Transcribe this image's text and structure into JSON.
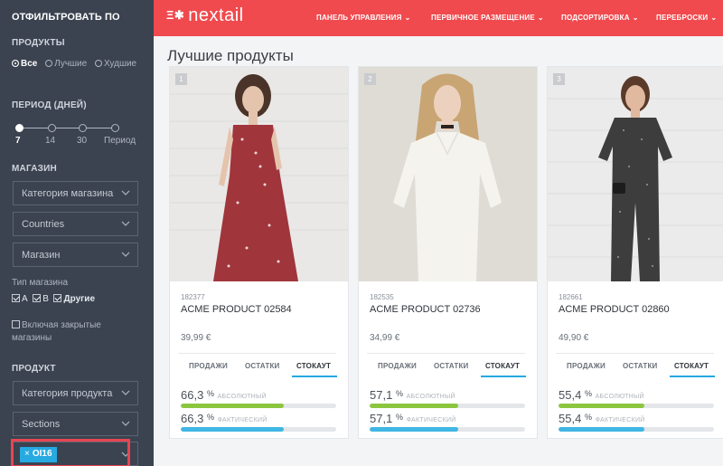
{
  "sidebar": {
    "title": "ОТФИЛЬТРОВАТЬ ПО",
    "products_heading": "ПРОДУКТЫ",
    "product_options": [
      "Все",
      "Лучшие",
      "Худшие"
    ],
    "product_selected": "Все",
    "period_heading": "ПЕРИОД (ДНЕЙ)",
    "period_options": [
      "7",
      "14",
      "30",
      "Период"
    ],
    "period_selected": "7",
    "stores_heading": "МАГАЗИН",
    "store_category": "Категория магазина",
    "countries": "Countries",
    "store": "Магазин",
    "store_type_label": "Тип магазина",
    "store_types": [
      "A",
      "B",
      "Другие"
    ],
    "include_closed": "Включая закрытые магазины",
    "product_heading": "ПРОДУКТ",
    "product_category": "Категория продукта",
    "sections": "Sections",
    "tag": "OI16",
    "tag_remove": "×"
  },
  "topbar": {
    "logo": "nextail",
    "logo_mark": "Ξ✱",
    "nav": [
      "ПАНЕЛЬ УПРАВЛЕНИЯ",
      "ПЕРВИЧНОЕ РАЗМЕЩЕНИЕ",
      "ПОДСОРТИРОВКА",
      "ПЕРЕБРОСКИ"
    ],
    "chevron": "⌄"
  },
  "main": {
    "title": "Лучшие продукты",
    "tabs": [
      "ПРОДАЖИ",
      "ОСТАТКИ",
      "СТОКАУТ"
    ],
    "metric_labels": [
      "АБСОЛЮТНЫЙ",
      "ФАКТИЧЕСКИЙ"
    ],
    "percent_sign": "%",
    "products": [
      {
        "rank": "1",
        "sku": "182377",
        "name": "ACME PRODUCT 02584",
        "price": "39,99 €",
        "absolute": "66,3",
        "actual": "66,3",
        "absolute_value": 66.3,
        "actual_value": 66.3
      },
      {
        "rank": "2",
        "sku": "182535",
        "name": "ACME PRODUCT 02736",
        "price": "34,99 €",
        "absolute": "57,1",
        "actual": "57,1",
        "absolute_value": 57.1,
        "actual_value": 57.1
      },
      {
        "rank": "3",
        "sku": "182661",
        "name": "ACME PRODUCT 02860",
        "price": "49,90 €",
        "absolute": "55,4",
        "actual": "55,4",
        "absolute_value": 55.4,
        "actual_value": 55.4
      }
    ]
  },
  "colors": {
    "brand_red": "#f04a4e",
    "sidebar_bg": "#3b4350",
    "accent_blue": "#27a9e1",
    "bar_green": "#8cc63f",
    "bar_blue": "#3fb6e3",
    "highlight_red": "#e74552"
  }
}
